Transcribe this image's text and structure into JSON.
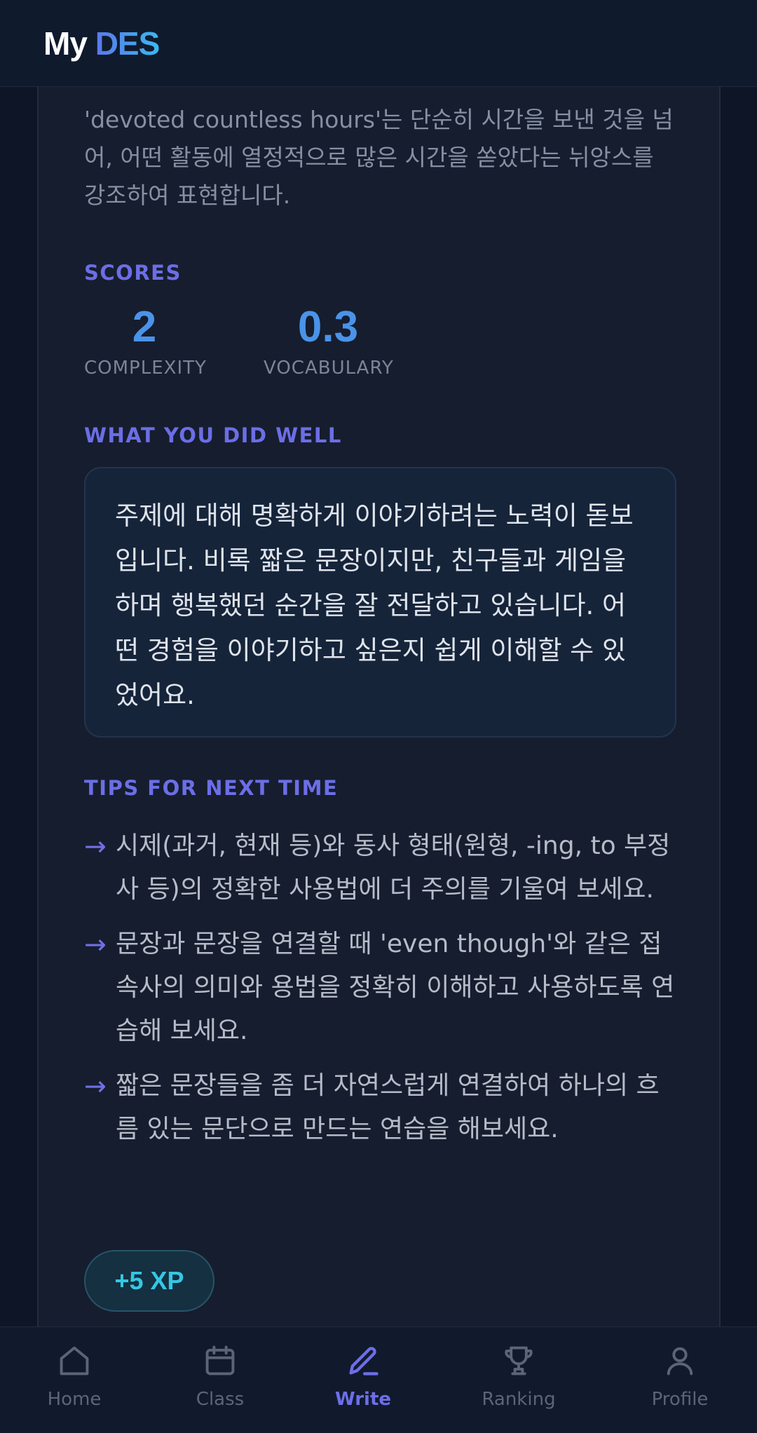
{
  "header": {
    "logo_part1": "My",
    "logo_part2": "DES"
  },
  "feedback": {
    "explanation": "'devoted countless hours'는 단순히 시간을 보낸 것을 넘어, 어떤 활동에 열정적으로 많은 시간을 쏟았다는 뉘앙스를 강조하여 표현합니다.",
    "scores_label": "SCORES",
    "scores": [
      {
        "value": "2",
        "label": "COMPLEXITY"
      },
      {
        "value": "0.3",
        "label": "VOCABULARY"
      }
    ],
    "well_label": "WHAT YOU DID WELL",
    "well_text": "주제에 대해 명확하게 이야기하려는 노력이 돋보입니다. 비록 짧은 문장이지만, 친구들과 게임을 하며 행복했던 순간을 잘 전달하고 있습니다. 어떤 경험을 이야기하고 싶은지 쉽게 이해할 수 있었어요.",
    "tips_label": "TIPS FOR NEXT TIME",
    "tips": [
      "시제(과거, 현재 등)와 동사 형태(원형, -ing, to 부정사 등)의 정확한 사용법에 더 주의를 기울여 보세요.",
      "문장과 문장을 연결할 때 'even though'와 같은 접속사의 의미와 용법을 정확히 이해하고 사용하도록 연습해 보세요.",
      "짧은 문장들을 좀 더 자연스럽게 연결하여 하나의 흐름 있는 문단으로 만드는 연습을 해보세요."
    ],
    "tip_arrow": "→",
    "xp_badge": "+5 XP"
  },
  "nav": {
    "active": "Write",
    "items": [
      {
        "label": "Home",
        "icon": "home-icon"
      },
      {
        "label": "Class",
        "icon": "calendar-icon"
      },
      {
        "label": "Write",
        "icon": "pen-icon"
      },
      {
        "label": "Ranking",
        "icon": "trophy-icon"
      },
      {
        "label": "Profile",
        "icon": "user-icon"
      }
    ]
  },
  "colors": {
    "background": "#0e1526",
    "card": "#161d2e",
    "accent_label": "#6c6ee6",
    "score_number": "#4a93e8",
    "xp_text": "#35c7e4"
  }
}
